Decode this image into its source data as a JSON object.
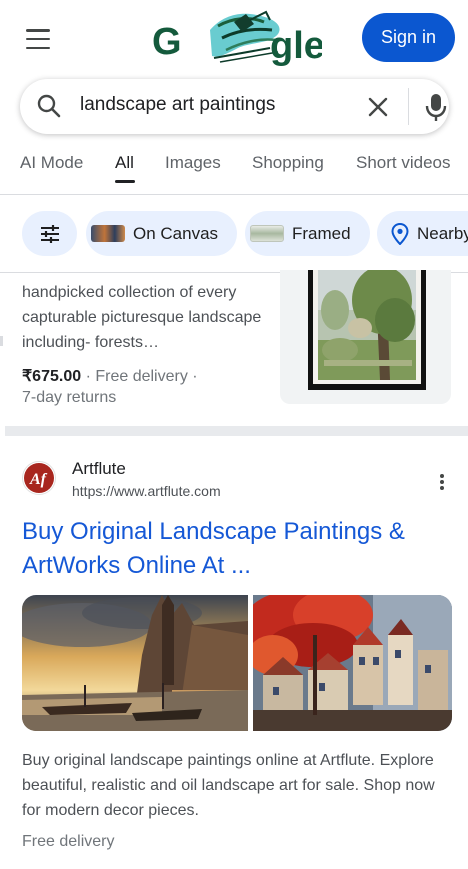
{
  "header": {
    "logo_text": "Google",
    "signin_label": "Sign in"
  },
  "search": {
    "query": "landscape art paintings"
  },
  "tabs": [
    {
      "label": "AI Mode"
    },
    {
      "label": "All"
    },
    {
      "label": "Images"
    },
    {
      "label": "Shopping"
    },
    {
      "label": "Short videos"
    }
  ],
  "chips": [
    {
      "label": ""
    },
    {
      "label": "On Canvas"
    },
    {
      "label": "Framed"
    },
    {
      "label": "Nearby"
    }
  ],
  "product": {
    "description": "handpicked collection of every capturable picturesque landscape including- forests…",
    "price": "₹675.00",
    "shipping": " · Free delivery ·",
    "returns": "7-day returns"
  },
  "result": {
    "site_name": "Artflute",
    "url": "https://www.artflute.com",
    "favicon_text": "Af",
    "title": "Buy Original Landscape Paintings & ArtWorks Online At ...",
    "snippet": "Buy original landscape paintings online at Artflute. Explore beautiful, realistic and oil landscape art for sale. Shop now for modern decor pieces.",
    "delivery": "Free delivery"
  },
  "colors": {
    "accent": "#0b57d0",
    "link": "#1558d6",
    "chip_bg": "#e8f0fe",
    "favicon_red": "#b3261e"
  },
  "icons": [
    "menu-icon",
    "search-icon",
    "clear-icon",
    "mic-icon",
    "filter-icon",
    "location-pin-icon",
    "more-vert-icon"
  ]
}
